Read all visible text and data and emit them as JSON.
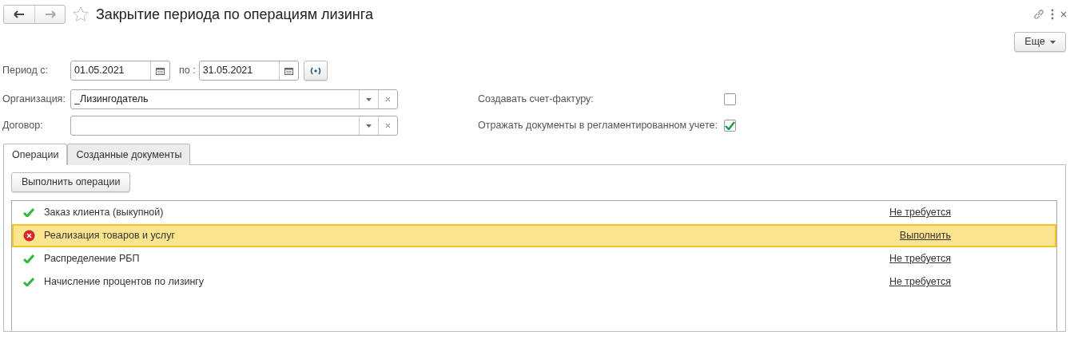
{
  "window": {
    "title": "Закрытие периода по операциям лизинга",
    "favorite": false
  },
  "more_button": "Еще",
  "period": {
    "from_label": "Период с:",
    "from": "01.05.2021",
    "to_label": "по :",
    "to": "31.05.2021"
  },
  "fields": [
    {
      "label": "Организация:",
      "value": "_Лизингодатель"
    },
    {
      "label": "Договор:"
    }
  ],
  "options": [
    {
      "label": "Создавать счет-фактуру:",
      "checked": false
    },
    {
      "label": "Отражать документы в регламентированном учете:",
      "checked": true
    }
  ],
  "tabs": [
    {
      "label": "Операции",
      "selected": true
    },
    {
      "label": "Созданные документы",
      "selected": false
    }
  ],
  "run_button": "Выполнить операции",
  "operations": [
    {
      "kind": "ok",
      "name": "Заказ клиента (выкупной)",
      "action": "Не требуется",
      "selected": false
    },
    {
      "kind": "error",
      "name": "Реализация товаров и услуг",
      "action": "Выполнить",
      "selected": true
    },
    {
      "kind": "ok",
      "name": "Распределение РБП",
      "action": "Не требуется",
      "selected": false
    },
    {
      "kind": "ok",
      "name": "Начисление процентов по лизингу",
      "action": "Не требуется",
      "selected": false
    }
  ]
}
